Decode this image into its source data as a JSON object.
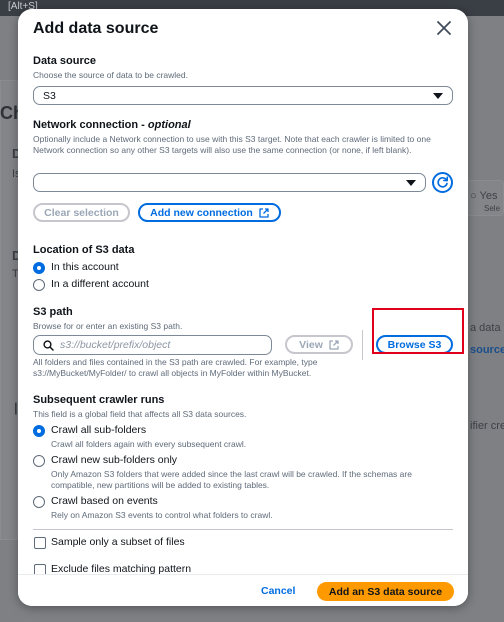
{
  "background": {
    "shortcut_hint": "[Alt+S]",
    "heading_fragment": "Ch",
    "letter_d1": "D",
    "letter_is": "Is",
    "letter_d2": "D",
    "letter_t": "T",
    "yes_text": "Yes",
    "sele_text": "Sele",
    "data_sou_text": "a data sou",
    "source_link": "source",
    "ifier_text": "ifier cre"
  },
  "modal": {
    "title": "Add data source",
    "data_source": {
      "label": "Data source",
      "description": "Choose the source of data to be crawled.",
      "selected": "S3"
    },
    "network": {
      "label": "Network connection - ",
      "label_optional": "optional",
      "description": "Optionally include a Network connection to use with this S3 target. Note that each crawler is limited to one Network connection so any other S3 targets will also use the same connection (or none, if left blank).",
      "selected": "",
      "clear_label": "Clear selection",
      "add_label": "Add new connection"
    },
    "location": {
      "label": "Location of S3 data",
      "options": [
        "In this account",
        "In a different account"
      ],
      "selected_index": 0
    },
    "s3_path": {
      "label": "S3 path",
      "description": "Browse for or enter an existing S3 path.",
      "placeholder": "s3://bucket/prefix/object",
      "view_label": "View",
      "browse_label": "Browse S3",
      "hint": "All folders and files contained in the S3 path are crawled. For example, type s3://MyBucket/MyFolder/ to crawl all objects in MyFolder within MyBucket."
    },
    "subsequent": {
      "label": "Subsequent crawler runs",
      "description": "This field is a global field that affects all S3 data sources.",
      "options": [
        {
          "label": "Crawl all sub-folders",
          "description": "Crawl all folders again with every subsequent crawl."
        },
        {
          "label": "Crawl new sub-folders only",
          "description": "Only Amazon S3 folders that were added since the last crawl will be crawled. If the schemas are compatible, new partitions will be added to existing tables."
        },
        {
          "label": "Crawl based on events",
          "description": "Rely on Amazon S3 events to control what folders to crawl."
        }
      ],
      "selected_index": 0
    },
    "checkboxes": {
      "sample": "Sample only a subset of files",
      "exclude": "Exclude files matching pattern"
    },
    "footer": {
      "cancel_label": "Cancel",
      "submit_label": "Add an S3 data source"
    }
  },
  "colors": {
    "accent": "#006ce0",
    "primary_button": "#ff9900",
    "highlight": "#e0001b"
  }
}
